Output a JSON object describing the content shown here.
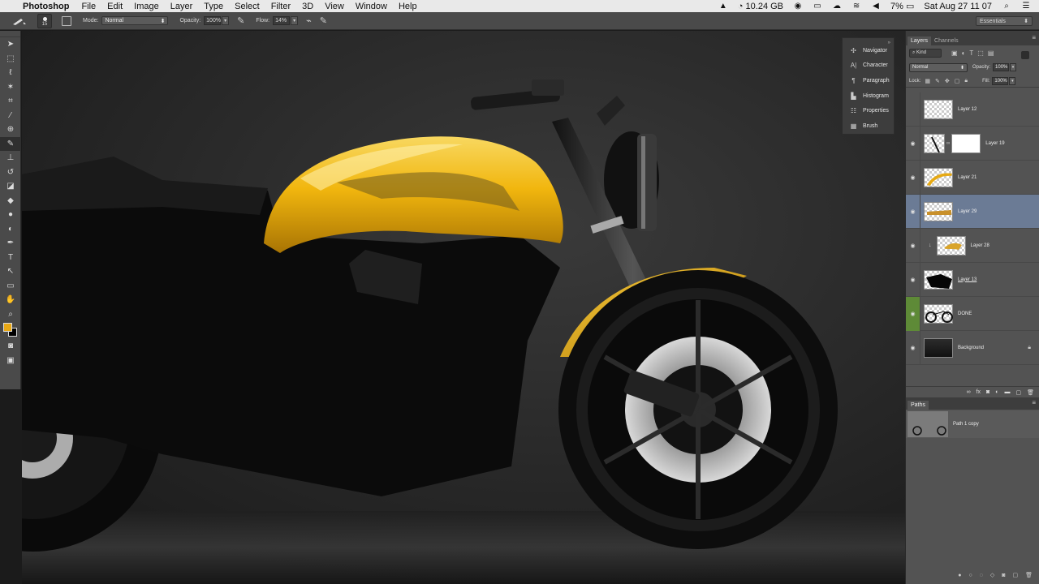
{
  "menubar": {
    "app_name": "Photoshop",
    "items": [
      "File",
      "Edit",
      "Image",
      "Layer",
      "Type",
      "Select",
      "Filter",
      "3D",
      "View",
      "Window",
      "Help"
    ],
    "memory": "10.24 GB",
    "battery": "7%",
    "datetime": "Sat Aug 27  11 07"
  },
  "options": {
    "brush_size": "15",
    "mode_label": "Mode:",
    "mode_value": "Normal",
    "opacity_label": "Opacity:",
    "opacity_value": "100%",
    "flow_label": "Flow:",
    "flow_value": "14%",
    "workspace": "Essentials"
  },
  "collapsed_panels": [
    {
      "label": "Navigator",
      "icon": "navigator-icon"
    },
    {
      "label": "Character",
      "icon": "character-icon"
    },
    {
      "label": "Paragraph",
      "icon": "paragraph-icon"
    },
    {
      "label": "Histogram",
      "icon": "histogram-icon"
    },
    {
      "label": "Properties",
      "icon": "properties-icon"
    },
    {
      "label": "Brush",
      "icon": "brush-icon"
    }
  ],
  "layers_panel": {
    "tabs": [
      "Layers",
      "Channels"
    ],
    "kind_filter": "Kind",
    "blend_mode": "Normal",
    "opacity_label": "Opacity:",
    "opacity_value": "100%",
    "lock_label": "Lock:",
    "fill_label": "Fill:",
    "fill_value": "100%",
    "layers": [
      {
        "name": "Layer 12",
        "visible": false
      },
      {
        "name": "Layer 19",
        "visible": true
      },
      {
        "name": "Layer 21",
        "visible": true
      },
      {
        "name": "Layer 29",
        "visible": true,
        "selected": true
      },
      {
        "name": "Layer 28",
        "visible": true
      },
      {
        "name": "Layer 13",
        "visible": true
      },
      {
        "name": "DONE",
        "visible": true
      },
      {
        "name": "Background",
        "visible": true,
        "locked": true
      }
    ]
  },
  "paths_panel": {
    "tab": "Paths",
    "paths": [
      {
        "name": "Path 1 copy"
      }
    ]
  },
  "colors": {
    "foreground": "#e8a815",
    "background": "#000000",
    "tank_yellow": "#f1b60e",
    "selected_layer": "#6b7b95"
  }
}
